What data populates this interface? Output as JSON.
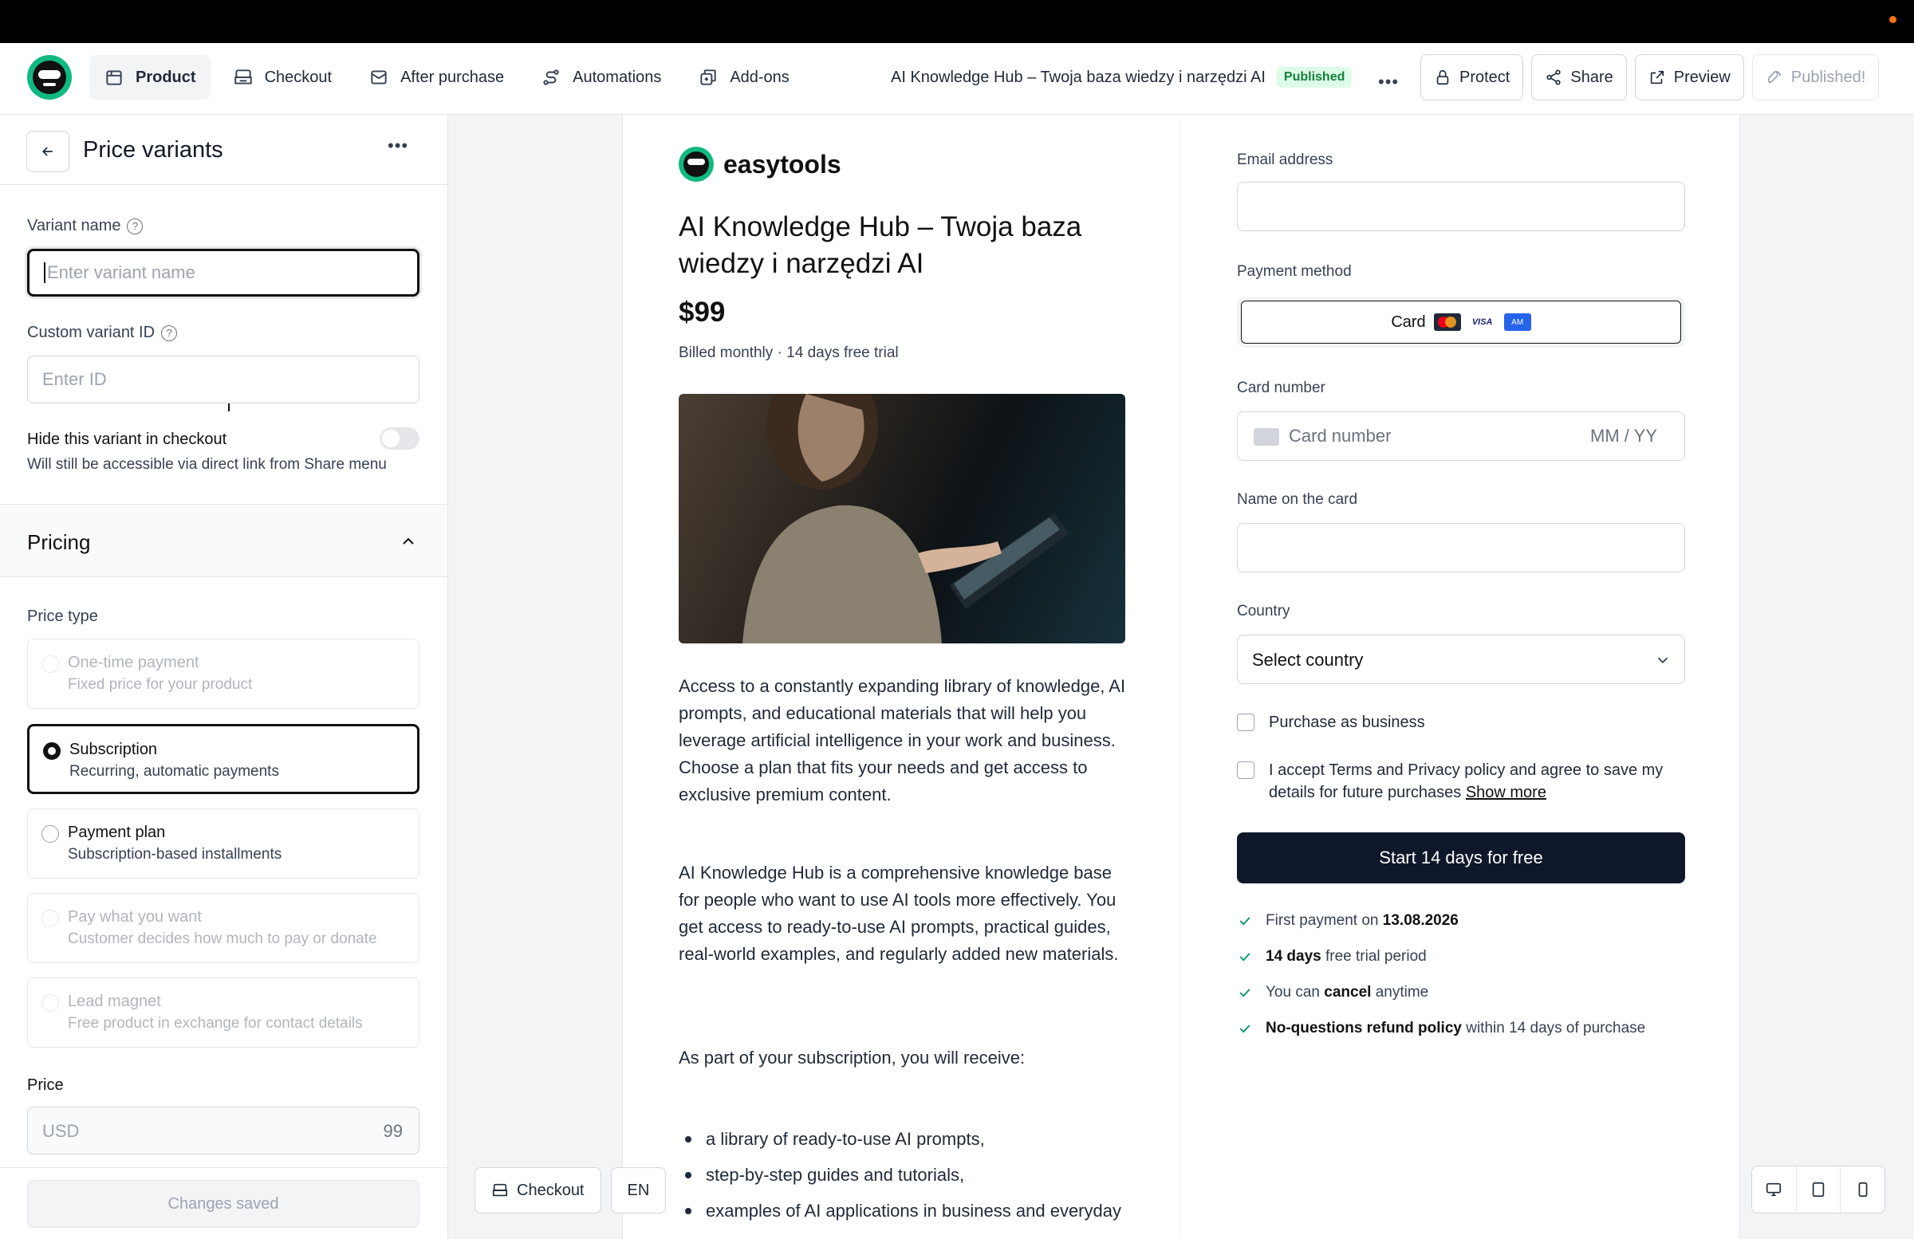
{
  "nav": {
    "tabs": [
      {
        "label": "Product",
        "icon": "box-icon"
      },
      {
        "label": "Checkout",
        "icon": "register-icon"
      },
      {
        "label": "After purchase",
        "icon": "inbox-icon"
      },
      {
        "label": "Automations",
        "icon": "route-icon"
      },
      {
        "label": "Add-ons",
        "icon": "addons-icon"
      }
    ],
    "doc_title": "AI Knowledge Hub – Twoja baza wiedzy i narzędzi AI",
    "status_badge": "Published",
    "buttons": {
      "protect": "Protect",
      "share": "Share",
      "preview": "Preview",
      "published": "Published!"
    }
  },
  "sidebar": {
    "title": "Price variants",
    "variant_name": {
      "label": "Variant name",
      "placeholder": "Enter variant name"
    },
    "custom_id": {
      "label": "Custom variant ID",
      "placeholder": "Enter ID"
    },
    "hide_toggle": {
      "label": "Hide this variant in checkout",
      "hint": "Will still be accessible via direct link from Share menu",
      "on": false
    },
    "pricing_section": "Pricing",
    "price_type_label": "Price type",
    "price_types": [
      {
        "title": "One-time payment",
        "subtitle": "Fixed price for your product",
        "state": "disabled"
      },
      {
        "title": "Subscription",
        "subtitle": "Recurring, automatic payments",
        "state": "selected"
      },
      {
        "title": "Payment plan",
        "subtitle": "Subscription-based installments",
        "state": "enabled"
      },
      {
        "title": "Pay what you want",
        "subtitle": "Customer decides how much to pay or donate",
        "state": "disabled"
      },
      {
        "title": "Lead magnet",
        "subtitle": "Free product in exchange for contact details",
        "state": "disabled"
      }
    ],
    "price": {
      "label": "Price",
      "currency": "USD",
      "value": "99"
    },
    "save_label": "Changes saved"
  },
  "product": {
    "brand": "easytools",
    "title": "AI Knowledge Hub – Twoja baza wiedzy i narzędzi AI",
    "price": "$99",
    "billing": "Billed monthly · 14 days free trial",
    "desc1": "Access to a constantly expanding library of knowledge, AI prompts, and educational materials that will help you leverage artificial intelligence in your work and business. Choose a plan that fits your needs and get access to exclusive premium content.",
    "desc2": "AI Knowledge Hub is a comprehensive knowledge base for people who want to use AI tools more effectively. You get access to ready-to-use AI prompts, practical guides, real-world examples, and regularly added new materials.",
    "desc3": "As part of your subscription, you will receive:",
    "bullets": [
      "a library of ready-to-use AI prompts,",
      "step-by-step guides and tutorials,",
      "examples of AI applications in business and everyday work"
    ]
  },
  "checkout": {
    "email_label": "Email address",
    "payment_label": "Payment method",
    "card_option": "Card",
    "card_brands": [
      "mastercard-icon",
      "visa-icon",
      "amex-icon"
    ],
    "card_number_label": "Card number",
    "card_number_placeholder": "Card number",
    "expiry_placeholder": "MM / YY",
    "name_label": "Name on the card",
    "country_label": "Country",
    "country_placeholder": "Select country",
    "business_label": "Purchase as business",
    "terms_label": "I accept Terms and Privacy policy and agree to save my details for future purchases",
    "show_more": "Show more",
    "start_button": "Start 14 days for free",
    "benefits": [
      {
        "pre": "First payment on ",
        "bold": "13.08.2026",
        "post": ""
      },
      {
        "pre": "",
        "bold": "14 days",
        "post": " free trial period"
      },
      {
        "pre": "You can ",
        "bold": "cancel",
        "post": " anytime"
      },
      {
        "pre": "",
        "bold": "No-questions refund policy",
        "post": " within 14 days of purchase"
      }
    ]
  },
  "floating": {
    "checkout_button": "Checkout",
    "language": "EN",
    "devices": [
      "desktop-icon",
      "tablet-icon",
      "mobile-icon"
    ]
  }
}
